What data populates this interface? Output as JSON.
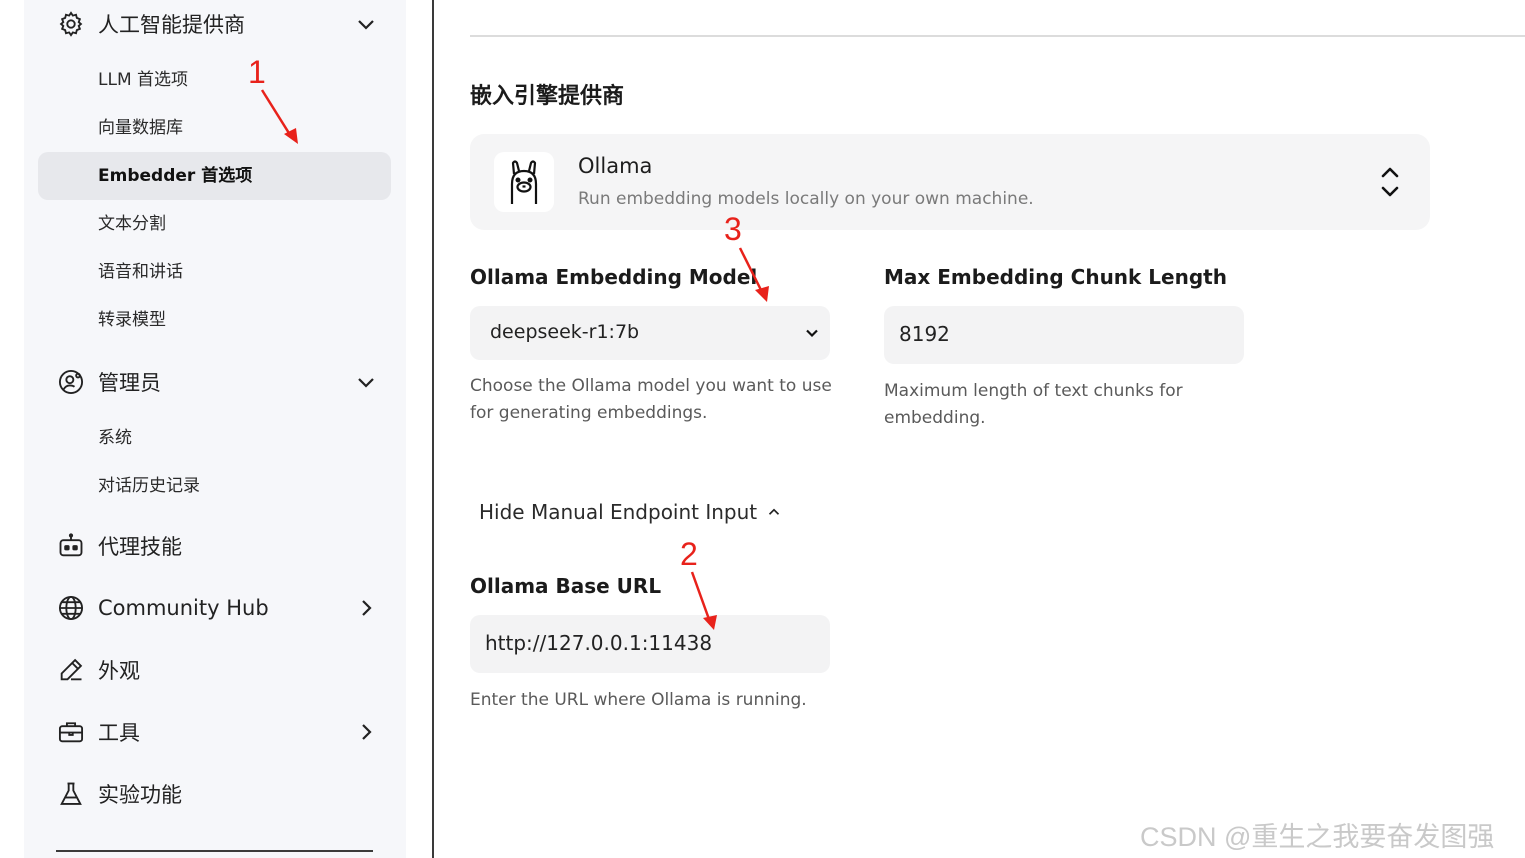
{
  "sidebar": {
    "groups": [
      {
        "label": "人工智能提供商",
        "icon": "gear-icon",
        "chevron": "down"
      },
      {
        "label": "管理员",
        "icon": "user-gear-icon",
        "chevron": "down"
      },
      {
        "label": "代理技能",
        "icon": "robot-icon"
      },
      {
        "label": "Community Hub",
        "icon": "globe-icon",
        "chevron": "right"
      },
      {
        "label": "外观",
        "icon": "pencil-icon"
      },
      {
        "label": "工具",
        "icon": "briefcase-icon",
        "chevron": "right"
      },
      {
        "label": "实验功能",
        "icon": "flask-icon"
      }
    ],
    "ai_provider_items": [
      "LLM 首选项",
      "向量数据库",
      "Embedder 首选项",
      "文本分割",
      "语音和讲话",
      "转录模型"
    ],
    "admin_items": [
      "系统",
      "对话历史记录"
    ]
  },
  "main": {
    "section_title": "嵌入引擎提供商",
    "provider": {
      "name": "Ollama",
      "description": "Run embedding models locally on your own machine.",
      "icon": "llama-icon"
    },
    "embedding_model": {
      "label": "Ollama Embedding Model",
      "value": "deepseek-r1:7b",
      "help": [
        "Choose the Ollama model you want to use",
        "for generating embeddings."
      ]
    },
    "chunk_length": {
      "label": "Max Embedding Chunk Length",
      "value": "8192",
      "help": [
        "Maximum length of text chunks for",
        "embedding."
      ]
    },
    "manual_toggle": "Hide Manual Endpoint Input",
    "base_url": {
      "label": "Ollama Base URL",
      "value": "http://127.0.0.1:11438",
      "help": "Enter the URL where Ollama is running."
    }
  },
  "annotations": [
    "1",
    "2",
    "3"
  ],
  "watermark": "CSDN @重生之我要奋发图强",
  "colors": {
    "annotation": "#e8221b",
    "sidebar_bg": "#f6f7fa",
    "active_item": "#e7e8ec"
  }
}
